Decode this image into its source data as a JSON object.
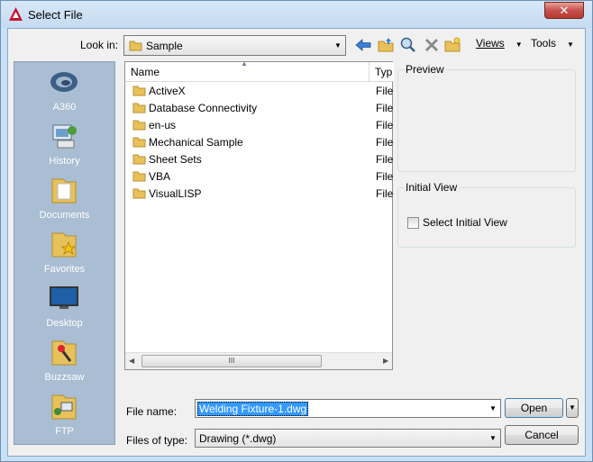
{
  "window": {
    "title": "Select File",
    "close_glyph": "✕"
  },
  "toolbar": {
    "look_in_label": "Look in:",
    "look_in_value": "Sample",
    "icons": [
      "back-arrow-icon",
      "up-folder-icon",
      "search-web-icon",
      "delete-icon",
      "new-folder-icon"
    ],
    "views_label": "Views",
    "tools_label": "Tools"
  },
  "places": [
    {
      "label": "A360",
      "icon": "a360-icon"
    },
    {
      "label": "History",
      "icon": "history-icon"
    },
    {
      "label": "Documents",
      "icon": "documents-folder-icon"
    },
    {
      "label": "Favorites",
      "icon": "favorites-folder-icon"
    },
    {
      "label": "Desktop",
      "icon": "desktop-monitor-icon"
    },
    {
      "label": "Buzzsaw",
      "icon": "buzzsaw-icon"
    },
    {
      "label": "FTP",
      "icon": "ftp-icon"
    }
  ],
  "file_list": {
    "columns": [
      "Name",
      "Typ"
    ],
    "rows": [
      {
        "name": "ActiveX",
        "type": "File"
      },
      {
        "name": "Database Connectivity",
        "type": "File"
      },
      {
        "name": "en-us",
        "type": "File"
      },
      {
        "name": "Mechanical Sample",
        "type": "File"
      },
      {
        "name": "Sheet Sets",
        "type": "File"
      },
      {
        "name": "VBA",
        "type": "File"
      },
      {
        "name": "VisualLISP",
        "type": "File"
      }
    ],
    "scroll_thumb_glyph": "III"
  },
  "preview": {
    "title": "Preview"
  },
  "initial_view": {
    "title": "Initial View",
    "checkbox_label": "Select Initial View",
    "checked": false
  },
  "bottom": {
    "file_name_label": "File name:",
    "file_name_value": "Welding Fixture-1.dwg",
    "files_of_type_label": "Files of type:",
    "files_of_type_value": "Drawing (*.dwg)",
    "open_label": "Open",
    "cancel_label": "Cancel"
  },
  "colors": {
    "places_bg": "#a9bdd3",
    "selection": "#3399ff",
    "folder": "#e8c15a"
  }
}
